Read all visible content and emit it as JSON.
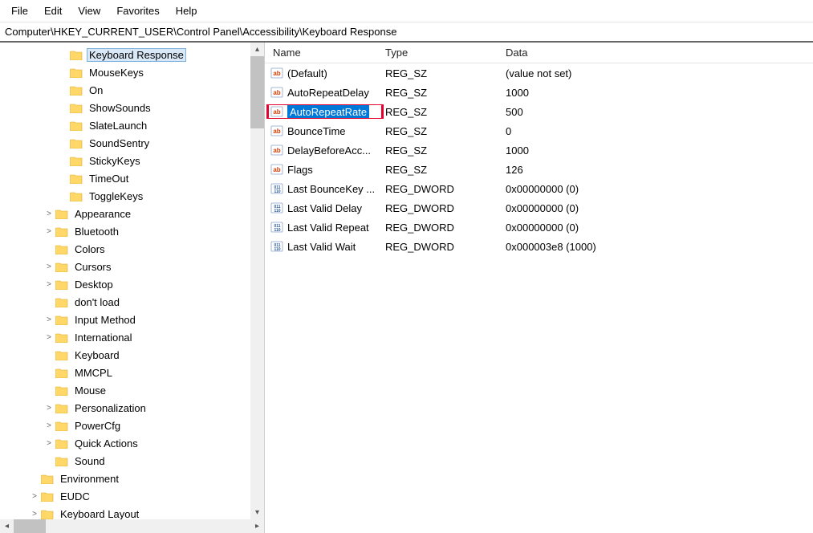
{
  "menu": {
    "file": "File",
    "edit": "Edit",
    "view": "View",
    "favorites": "Favorites",
    "help": "Help"
  },
  "address": "Computer\\HKEY_CURRENT_USER\\Control Panel\\Accessibility\\Keyboard Response",
  "tree": [
    {
      "indent": 4,
      "exp": "",
      "label": "Keyboard Response",
      "selected": true
    },
    {
      "indent": 4,
      "exp": "",
      "label": "MouseKeys"
    },
    {
      "indent": 4,
      "exp": "",
      "label": "On"
    },
    {
      "indent": 4,
      "exp": "",
      "label": "ShowSounds"
    },
    {
      "indent": 4,
      "exp": "",
      "label": "SlateLaunch"
    },
    {
      "indent": 4,
      "exp": "",
      "label": "SoundSentry"
    },
    {
      "indent": 4,
      "exp": "",
      "label": "StickyKeys"
    },
    {
      "indent": 4,
      "exp": "",
      "label": "TimeOut"
    },
    {
      "indent": 4,
      "exp": "",
      "label": "ToggleKeys"
    },
    {
      "indent": 3,
      "exp": ">",
      "label": "Appearance"
    },
    {
      "indent": 3,
      "exp": ">",
      "label": "Bluetooth"
    },
    {
      "indent": 3,
      "exp": "",
      "label": "Colors"
    },
    {
      "indent": 3,
      "exp": ">",
      "label": "Cursors"
    },
    {
      "indent": 3,
      "exp": ">",
      "label": "Desktop"
    },
    {
      "indent": 3,
      "exp": "",
      "label": "don't load"
    },
    {
      "indent": 3,
      "exp": ">",
      "label": "Input Method"
    },
    {
      "indent": 3,
      "exp": ">",
      "label": "International"
    },
    {
      "indent": 3,
      "exp": "",
      "label": "Keyboard"
    },
    {
      "indent": 3,
      "exp": "",
      "label": "MMCPL"
    },
    {
      "indent": 3,
      "exp": "",
      "label": "Mouse"
    },
    {
      "indent": 3,
      "exp": ">",
      "label": "Personalization"
    },
    {
      "indent": 3,
      "exp": ">",
      "label": "PowerCfg"
    },
    {
      "indent": 3,
      "exp": ">",
      "label": "Quick Actions"
    },
    {
      "indent": 3,
      "exp": "",
      "label": "Sound"
    },
    {
      "indent": 2,
      "exp": "",
      "label": "Environment"
    },
    {
      "indent": 2,
      "exp": ">",
      "label": "EUDC"
    },
    {
      "indent": 2,
      "exp": ">",
      "label": "Keyboard Layout"
    }
  ],
  "columns": {
    "name": "Name",
    "type": "Type",
    "data": "Data"
  },
  "values": [
    {
      "name": "(Default)",
      "type": "REG_SZ",
      "data": "(value not set)",
      "kind": "sz"
    },
    {
      "name": "AutoRepeatDelay",
      "type": "REG_SZ",
      "data": "1000",
      "kind": "sz"
    },
    {
      "name": "AutoRepeatRate",
      "type": "REG_SZ",
      "data": "500",
      "kind": "sz",
      "highlight": true
    },
    {
      "name": "BounceTime",
      "type": "REG_SZ",
      "data": "0",
      "kind": "sz"
    },
    {
      "name": "DelayBeforeAcc...",
      "type": "REG_SZ",
      "data": "1000",
      "kind": "sz"
    },
    {
      "name": "Flags",
      "type": "REG_SZ",
      "data": "126",
      "kind": "sz"
    },
    {
      "name": "Last BounceKey ...",
      "type": "REG_DWORD",
      "data": "0x00000000 (0)",
      "kind": "dw"
    },
    {
      "name": "Last Valid Delay",
      "type": "REG_DWORD",
      "data": "0x00000000 (0)",
      "kind": "dw"
    },
    {
      "name": "Last Valid Repeat",
      "type": "REG_DWORD",
      "data": "0x00000000 (0)",
      "kind": "dw"
    },
    {
      "name": "Last Valid Wait",
      "type": "REG_DWORD",
      "data": "0x000003e8 (1000)",
      "kind": "dw"
    }
  ]
}
